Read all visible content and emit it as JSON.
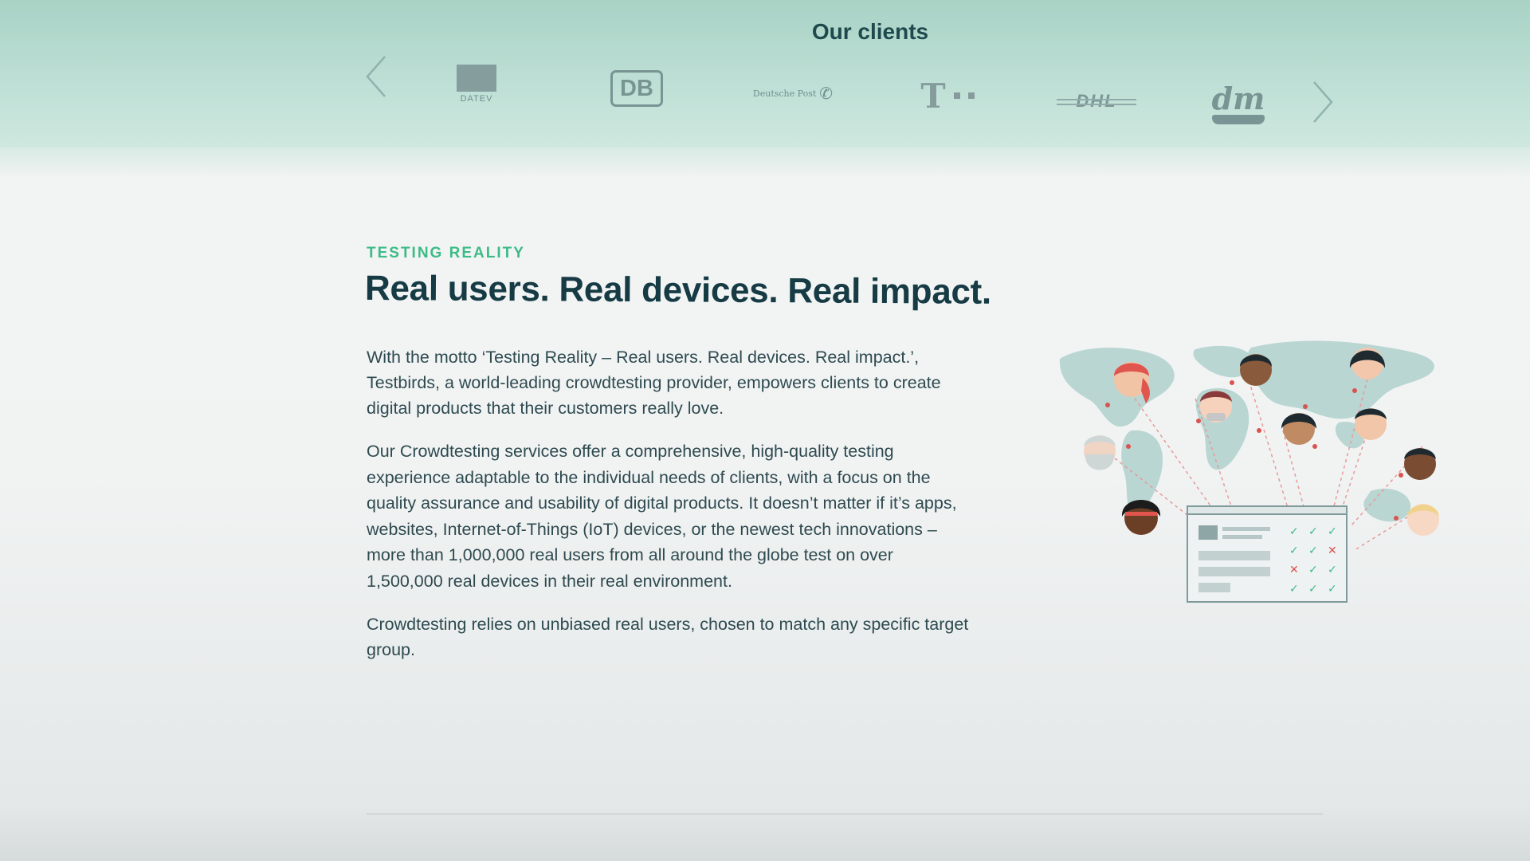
{
  "clients": {
    "title": "Our clients",
    "prev_label": "Previous",
    "next_label": "Next",
    "logos": [
      {
        "name": "DATEV",
        "text": "DATEV"
      },
      {
        "name": "DB",
        "text": "DB"
      },
      {
        "name": "Deutsche Post",
        "text": "Deutsche Post"
      },
      {
        "name": "Telekom",
        "text": "T"
      },
      {
        "name": "DHL",
        "text": "DHL"
      },
      {
        "name": "dm",
        "text": "dm"
      }
    ]
  },
  "section": {
    "eyebrow": "TESTING REALITY",
    "headline": "Real users. Real devices. Real impact.",
    "paragraphs": [
      "With the motto ‘Testing Reality – Real users. Real devices. Real impact.’, Testbirds, a world-leading crowdtesting provider, empowers clients to create digital products that their customers really love.",
      "Our Crowdtesting services offer a comprehensive, high-quality testing experience adaptable to the individual needs of clients, with a focus on the quality assurance and usability of digital products. It doesn’t matter if it’s apps, websites, Internet-of-Things (IoT) devices, or the newest tech innovations – more than 1,000,000 real users from all around the globe test on over 1,500,000 real devices in their real environment.",
      "Crowdtesting relies on unbiased real users, chosen to match any specific target group."
    ]
  },
  "colors": {
    "band": "#bfe0d6",
    "accent": "#3dbb86",
    "heading": "#163b44",
    "body": "#2e4a50"
  },
  "icons": [
    "chevron-left-icon",
    "chevron-right-icon"
  ]
}
